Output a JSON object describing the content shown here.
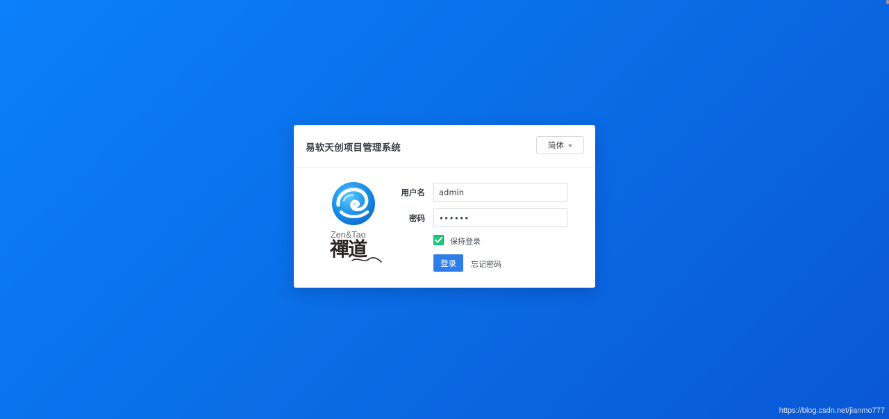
{
  "header": {
    "title": "易软天创项目管理系统",
    "language_selected": "简体"
  },
  "logo": {
    "brand_en": "Zen&Tao",
    "brand_cn": "禪道",
    "icon": "zentao-swirl-icon"
  },
  "form": {
    "username_label": "用户名",
    "username_value": "admin",
    "password_label": "密码",
    "password_value": "••••••",
    "keep_login_label": "保持登录",
    "keep_login_checked": true,
    "login_button": "登录",
    "forgot_password": "忘记密码"
  },
  "watermark": "https://blog.csdn.net/jianmo777",
  "colors": {
    "background": "#0a6fe8",
    "primary_button": "#2f7de8",
    "checkbox": "#20c97e"
  }
}
